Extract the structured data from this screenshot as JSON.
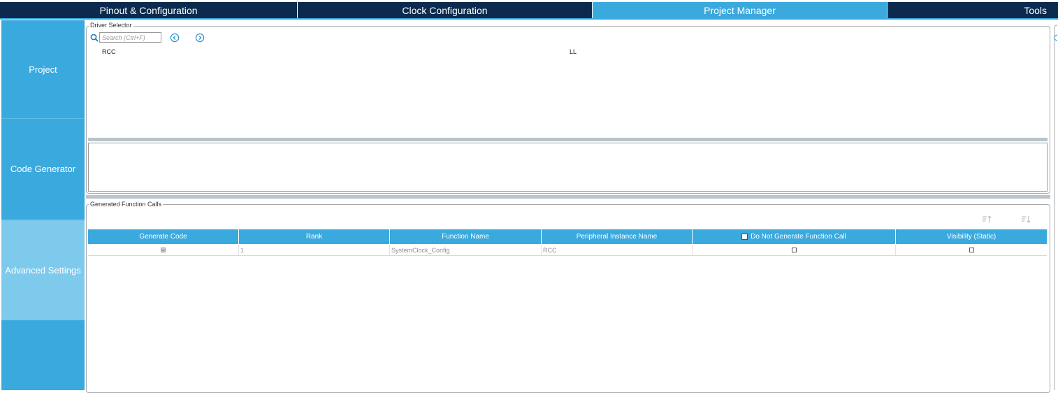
{
  "tabs": [
    {
      "label": "Pinout & Configuration",
      "active": false
    },
    {
      "label": "Clock Configuration",
      "active": false
    },
    {
      "label": "Project Manager",
      "active": true
    },
    {
      "label": "Tools",
      "active": false
    }
  ],
  "sidebar": {
    "items": [
      {
        "label": "Project",
        "active": false
      },
      {
        "label": "Code Generator",
        "active": false
      },
      {
        "label": "Advanced Settings",
        "active": true
      }
    ]
  },
  "driver_selector": {
    "title": "Driver Selector",
    "search_placeholder": "Search (Ctrl+F)",
    "rows": [
      {
        "peripheral": "RCC",
        "driver": "LL"
      }
    ]
  },
  "generated_calls": {
    "title": "Generated Function Calls",
    "columns": [
      "Generate Code",
      "Rank",
      "Function Name",
      "Peripheral Instance Name",
      "Do Not Generate Function Call",
      "Visibility (Static)"
    ],
    "rows": [
      {
        "generate_code": true,
        "rank": "1",
        "function_name": "SystemClock_Config",
        "instance": "RCC",
        "do_not_generate": false,
        "visibility_static": false
      }
    ]
  },
  "colors": {
    "navy": "#0b2a4e",
    "accent": "#3aa9de",
    "sidebar_active": "#7ecaec"
  },
  "icons": [
    "search-icon",
    "back-arrow-icon",
    "forward-arrow-icon",
    "sort-ascending-icon",
    "sort-descending-icon"
  ]
}
